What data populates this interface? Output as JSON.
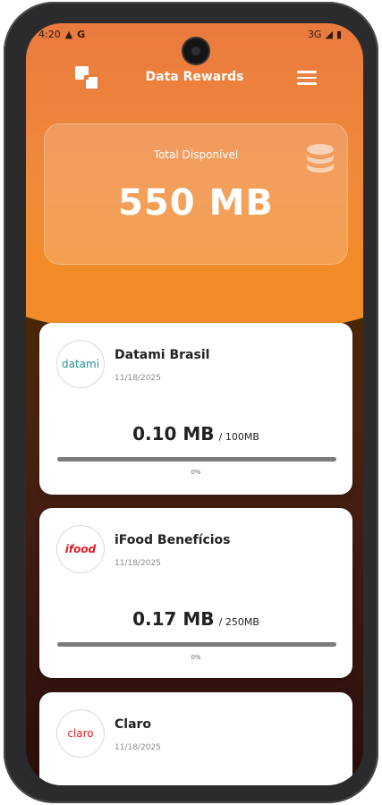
{
  "status_bar": {
    "time": "4:20",
    "network": "3G"
  },
  "app": {
    "title": "Data Rewards"
  },
  "total": {
    "label": "Total Disponível",
    "value": "550 MB"
  },
  "rewards": [
    {
      "name": "Datami Brasil",
      "date": "11/18/2025",
      "used": "0.10 MB",
      "total": "/ 100MB",
      "percent_text": "0%",
      "progress": 0,
      "logo_text": "datami",
      "logo_color": "#2a8f9a"
    },
    {
      "name": "iFood Benefícios",
      "date": "11/18/2025",
      "used": "0.17 MB",
      "total": "/ 250MB",
      "percent_text": "0%",
      "progress": 0,
      "logo_text": "ifood",
      "logo_color": "#e31b23"
    },
    {
      "name": "Claro",
      "date": "11/18/2025",
      "logo_text": "claro",
      "logo_color": "#e31b23"
    }
  ],
  "colors": {
    "accent": "#f28c2a",
    "header_top": "#ea7a3e",
    "background_dark": "#3f1a12"
  }
}
